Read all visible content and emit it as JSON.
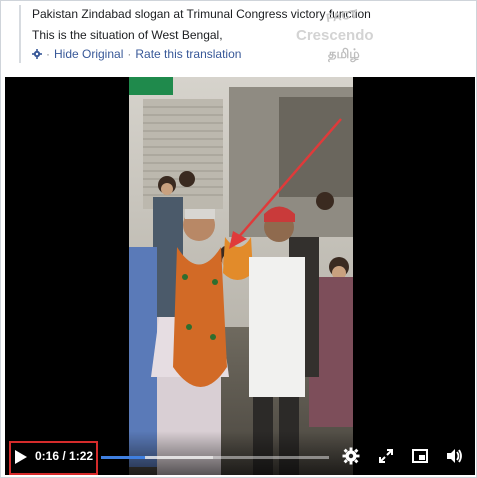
{
  "post": {
    "caption_line1": "Pakistan Zindabad slogan at Trimunal Congress victory function",
    "caption_line2": "This is the situation of West Bengal,",
    "hide_original": "Hide Original",
    "separator": "·",
    "rate_translation": "Rate this translation"
  },
  "watermark": {
    "fact": "FACT",
    "brand": "Crescendo",
    "language": "தமிழ்"
  },
  "video": {
    "current_time": "0:16",
    "duration": "1:22",
    "time_display": "0:16 / 1:22",
    "progress_fraction": 0.195,
    "buffered_fraction": 0.49,
    "accent_color": "#3f7fe0",
    "highlight_color": "#d52b2b",
    "annotation_arrow_color": "#e03a3a"
  },
  "icons": {
    "translate": "gear-icon",
    "play": "play-icon",
    "settings": "settings-gear-icon",
    "fullscreen": "fullscreen-icon",
    "pip": "picture-in-picture-icon",
    "volume": "volume-icon"
  }
}
